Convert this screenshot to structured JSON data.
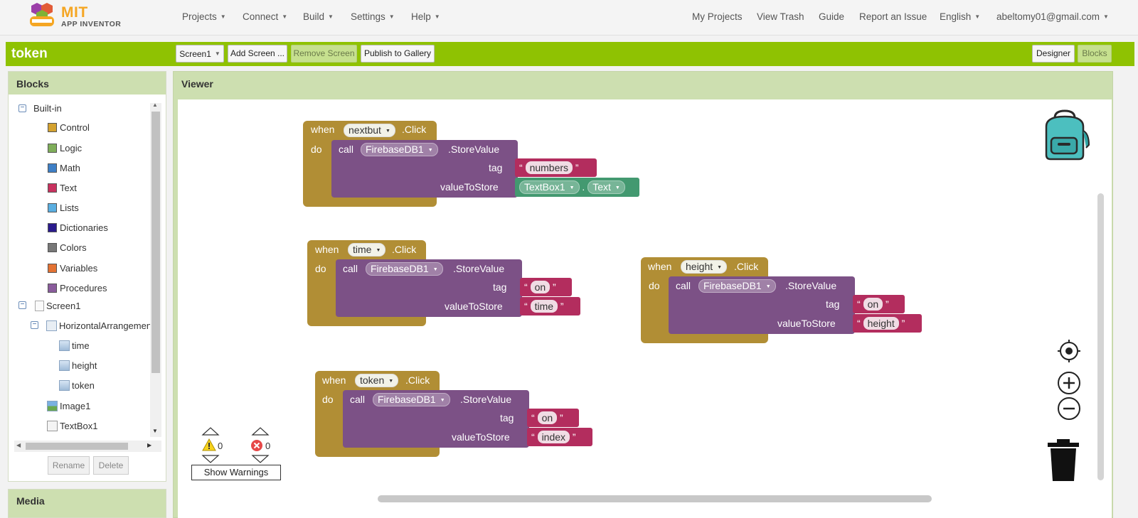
{
  "header": {
    "logo_line1": "MIT",
    "logo_line2": "APP INVENTOR",
    "menus": [
      "Projects",
      "Connect",
      "Build",
      "Settings",
      "Help"
    ],
    "right_links": [
      "My Projects",
      "View Trash",
      "Guide",
      "Report an Issue"
    ],
    "language": "English",
    "user_email": "abeltomy01@gmail.com"
  },
  "project_bar": {
    "title": "token",
    "screen_select": "Screen1",
    "add_screen": "Add Screen ...",
    "remove_screen": "Remove Screen",
    "publish": "Publish to Gallery",
    "designer": "Designer",
    "blocks": "Blocks"
  },
  "blocks_panel": {
    "title": "Blocks",
    "builtin_label": "Built-in",
    "builtin_items": [
      {
        "label": "Control",
        "color": "#d4a22f"
      },
      {
        "label": "Logic",
        "color": "#7fae5a"
      },
      {
        "label": "Math",
        "color": "#3e7fc6"
      },
      {
        "label": "Text",
        "color": "#c8325f"
      },
      {
        "label": "Lists",
        "color": "#5aaee0"
      },
      {
        "label": "Dictionaries",
        "color": "#2a1b8c"
      },
      {
        "label": "Colors",
        "color": "#777777"
      },
      {
        "label": "Variables",
        "color": "#e37233"
      },
      {
        "label": "Procedures",
        "color": "#8a5c9c"
      }
    ],
    "screen_label": "Screen1",
    "arrangement_label": "HorizontalArrangemen",
    "arrangement_children": [
      "time",
      "height",
      "token"
    ],
    "image_label": "Image1",
    "textbox_label": "TextBox1",
    "rename": "Rename",
    "delete": "Delete"
  },
  "media_panel": {
    "title": "Media"
  },
  "viewer": {
    "title": "Viewer",
    "kw_when": "when",
    "kw_do": "do",
    "kw_call": "call",
    "kw_click": ".Click",
    "kw_store": ".StoreValue",
    "kw_tag": "tag",
    "kw_value": "valueToStore",
    "firebase": "FirebaseDB1",
    "quote_open": "“",
    "quote_close": "”",
    "block_nextbut": {
      "component": "nextbut",
      "tag": "numbers",
      "value_component": "TextBox1",
      "value_property": "Text",
      "dot": "."
    },
    "block_time": {
      "component": "time",
      "tag": "on",
      "value": "time"
    },
    "block_height": {
      "component": "height",
      "tag": "on",
      "value": "height"
    },
    "block_token": {
      "component": "token",
      "tag": "on",
      "value": "index"
    },
    "warnings_count": "0",
    "errors_count": "0",
    "show_warnings": "Show Warnings"
  }
}
